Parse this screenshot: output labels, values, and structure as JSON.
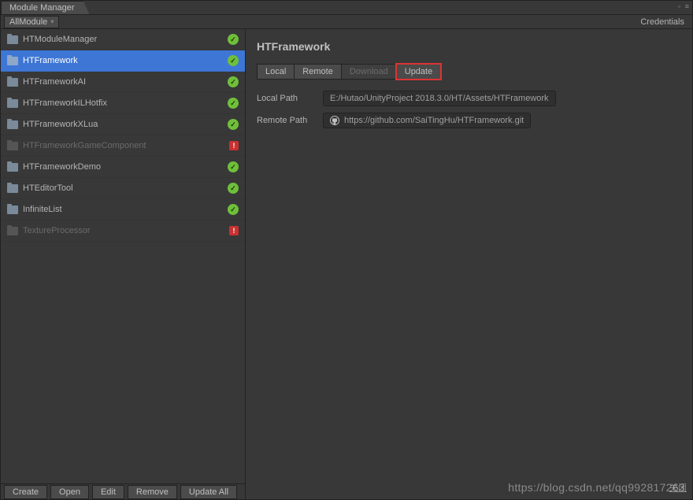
{
  "window": {
    "title": "Module Manager"
  },
  "toolbar": {
    "filter": "AllModule",
    "credentials": "Credentials"
  },
  "modules": [
    {
      "name": "HTModuleManager",
      "status": "ok",
      "selected": false,
      "disabled": false
    },
    {
      "name": "HTFramework",
      "status": "ok",
      "selected": true,
      "disabled": false
    },
    {
      "name": "HTFrameworkAI",
      "status": "ok",
      "selected": false,
      "disabled": false
    },
    {
      "name": "HTFrameworkILHotfix",
      "status": "ok",
      "selected": false,
      "disabled": false
    },
    {
      "name": "HTFrameworkXLua",
      "status": "ok",
      "selected": false,
      "disabled": false
    },
    {
      "name": "HTFrameworkGameComponent",
      "status": "err",
      "selected": false,
      "disabled": true
    },
    {
      "name": "HTFrameworkDemo",
      "status": "ok",
      "selected": false,
      "disabled": false
    },
    {
      "name": "HTEditorTool",
      "status": "ok",
      "selected": false,
      "disabled": false
    },
    {
      "name": "InfiniteList",
      "status": "ok",
      "selected": false,
      "disabled": false
    },
    {
      "name": "TextureProcessor",
      "status": "err",
      "selected": false,
      "disabled": true
    }
  ],
  "bottomButtons": {
    "create": "Create",
    "open": "Open",
    "edit": "Edit",
    "remove": "Remove",
    "updateAll": "Update All"
  },
  "detail": {
    "title": "HTFramework",
    "tabs": {
      "local": "Local",
      "remote": "Remote",
      "download": "Download",
      "update": "Update"
    },
    "localPathLabel": "Local Path",
    "localPath": "E:/Hutao/UnityProject 2018.3.0/HT/Assets/HTFramework",
    "remotePathLabel": "Remote Path",
    "remotePath": "https://github.com/SaiTingHu/HTFramework.git"
  },
  "watermark": "https://blog.csdn.net/qq992817263",
  "closeLink": "关闭"
}
